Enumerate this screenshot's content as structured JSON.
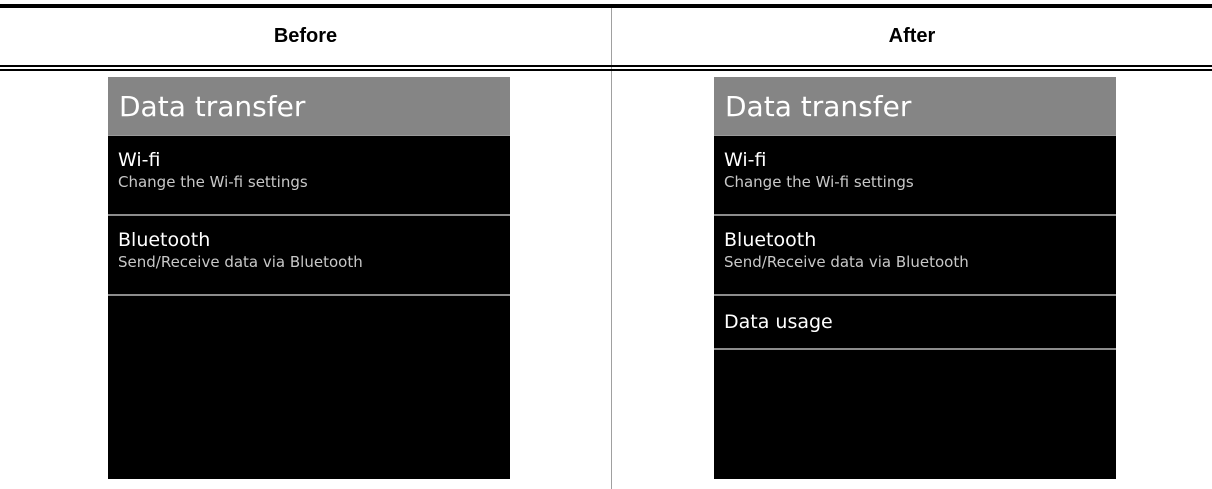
{
  "columns": {
    "before_label": "Before",
    "after_label": "After"
  },
  "before": {
    "title": "Data transfer",
    "items": [
      {
        "title": "Wi-fi",
        "subtitle": "Change the Wi-fi settings"
      },
      {
        "title": "Bluetooth",
        "subtitle": "Send/Receive data via Bluetooth"
      }
    ]
  },
  "after": {
    "title": "Data transfer",
    "items": [
      {
        "title": "Wi-fi",
        "subtitle": "Change the Wi-fi settings"
      },
      {
        "title": "Bluetooth",
        "subtitle": "Send/Receive data via Bluetooth"
      },
      {
        "title": "Data usage"
      }
    ]
  },
  "colors": {
    "title_bar": "#858585",
    "screen_bg": "#000000",
    "separator": "#8c8c8c"
  }
}
